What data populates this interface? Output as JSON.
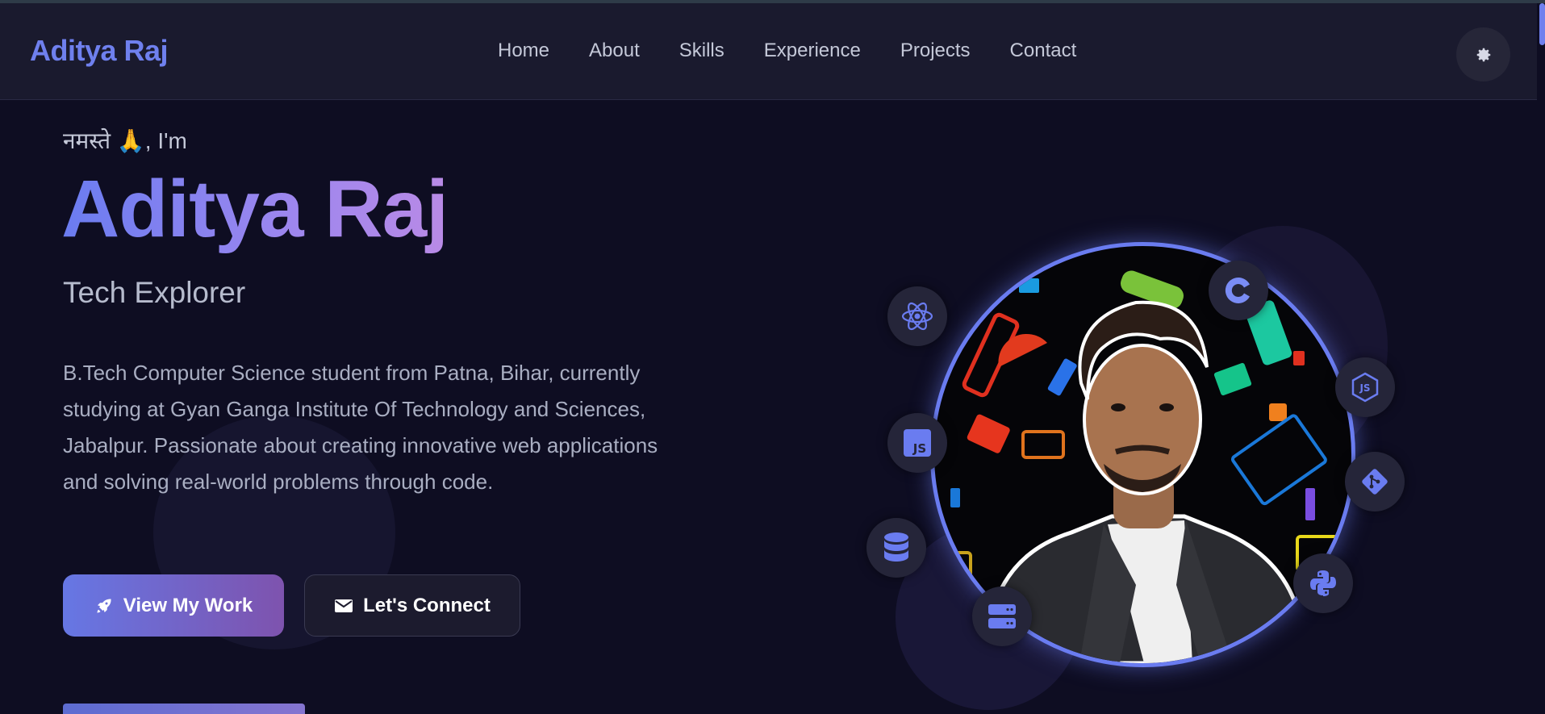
{
  "nav": {
    "brand": "Aditya Raj",
    "items": [
      "Home",
      "About",
      "Skills",
      "Experience",
      "Projects",
      "Contact"
    ],
    "theme_toggle_icon": "gear-icon"
  },
  "hero": {
    "greeting": "नमस्ते 🙏, I'm",
    "name": "Aditya Raj",
    "role": "Tech Explorer",
    "bio": "B.Tech Computer Science student from Patna, Bihar, currently studying at Gyan Ganga Institute Of Technology and Sciences, Jabalpur. Passionate about creating innovative web applications and solving real-world problems through code.",
    "primary_button": {
      "label": "View My Work",
      "icon": "rocket-icon"
    },
    "secondary_button": {
      "label": "Let's Connect",
      "icon": "envelope-icon"
    }
  },
  "tech_badges": [
    "react-icon",
    "c-icon",
    "nodejs-icon",
    "javascript-icon",
    "git-icon",
    "database-icon",
    "python-icon",
    "server-icon"
  ],
  "colors": {
    "accent": "#6a7cf0",
    "gradient_end": "#b98ae6",
    "background": "#0e0d22",
    "nav_background": "#1a1a2e"
  }
}
